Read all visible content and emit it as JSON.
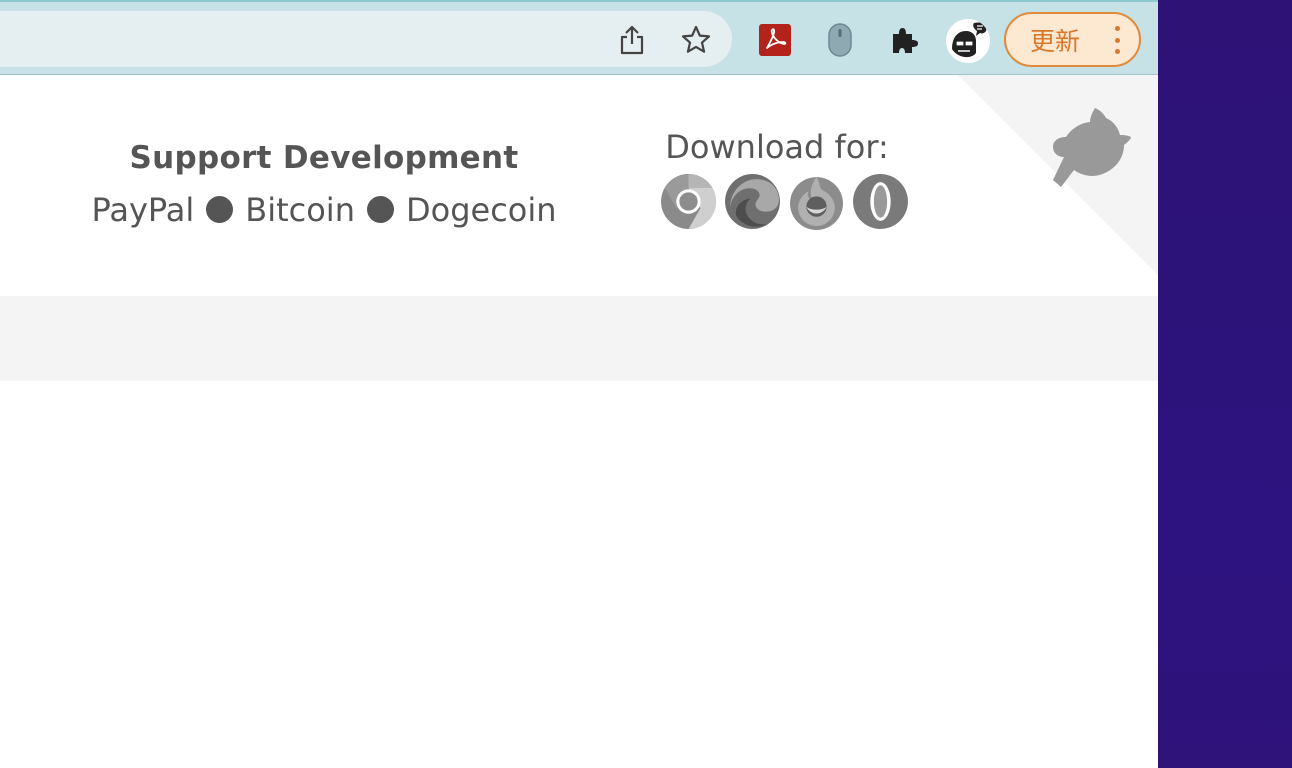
{
  "toolbar": {
    "icons": [
      "share-icon",
      "star-icon",
      "acrobat-icon",
      "mouse-extension-icon",
      "puzzle-icon",
      "avatar"
    ],
    "update_label": "更新",
    "accent": "#e08a3c"
  },
  "support": {
    "title": "Support Development",
    "links": [
      "PayPal",
      "Bitcoin",
      "Dogecoin"
    ]
  },
  "download": {
    "title": "Download for:",
    "browsers": [
      "chrome-icon",
      "edge-icon",
      "firefox-icon",
      "opera-icon"
    ]
  },
  "colors": {
    "toolbar_bg": "#c6e2e6",
    "text": "#555555",
    "desktop_bg": "#2e1276"
  }
}
